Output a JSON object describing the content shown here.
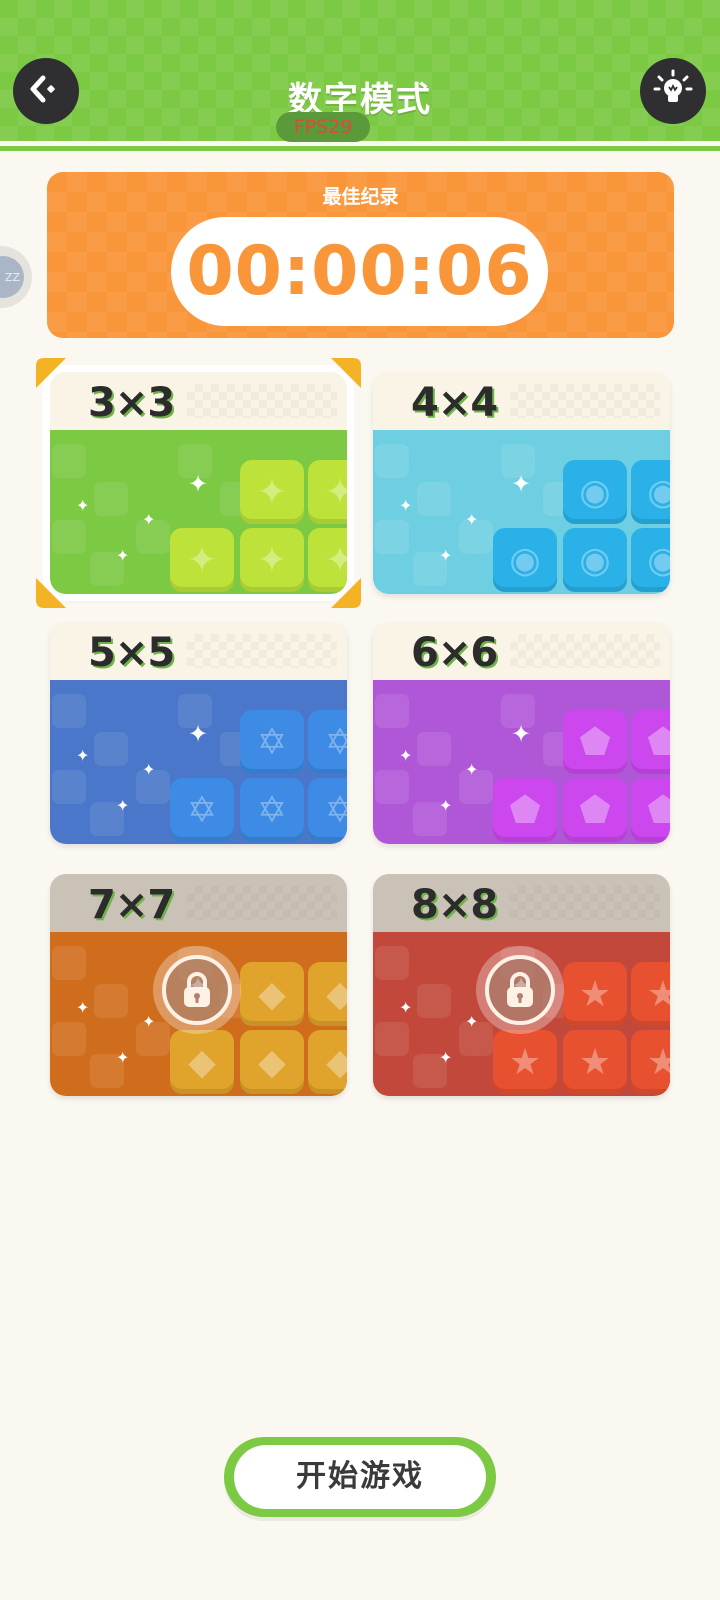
{
  "header": {
    "title": "数字模式",
    "fps_label": "FPS29",
    "back_icon": "back-arrow-icon",
    "hint_icon": "lightbulb-icon"
  },
  "side_tab": {
    "text": "ZZ"
  },
  "best_record": {
    "label": "最佳纪录",
    "time": "00:00:06"
  },
  "levels": [
    {
      "label": "3×3",
      "color": "#7cc944",
      "tile_color": "#bde33a",
      "tile_glyph": "✦",
      "locked": false,
      "selected": true
    },
    {
      "label": "4×4",
      "color": "#6ecfe2",
      "tile_color": "#29b1e8",
      "tile_glyph": "◉",
      "locked": false,
      "selected": false
    },
    {
      "label": "5×5",
      "color": "#4a77c9",
      "tile_color": "#3d8be4",
      "tile_glyph": "✡",
      "locked": false,
      "selected": false
    },
    {
      "label": "6×6",
      "color": "#b057d8",
      "tile_color": "#cd47ee",
      "tile_glyph": "⬟",
      "locked": false,
      "selected": false
    },
    {
      "label": "7×7",
      "color": "#d06d1d",
      "tile_color": "#e0a32b",
      "tile_glyph": "◆",
      "locked": true,
      "selected": false
    },
    {
      "label": "8×8",
      "color": "#c2483b",
      "tile_color": "#e8512f",
      "tile_glyph": "★",
      "locked": true,
      "selected": false
    }
  ],
  "start_button": {
    "label": "开始游戏"
  }
}
